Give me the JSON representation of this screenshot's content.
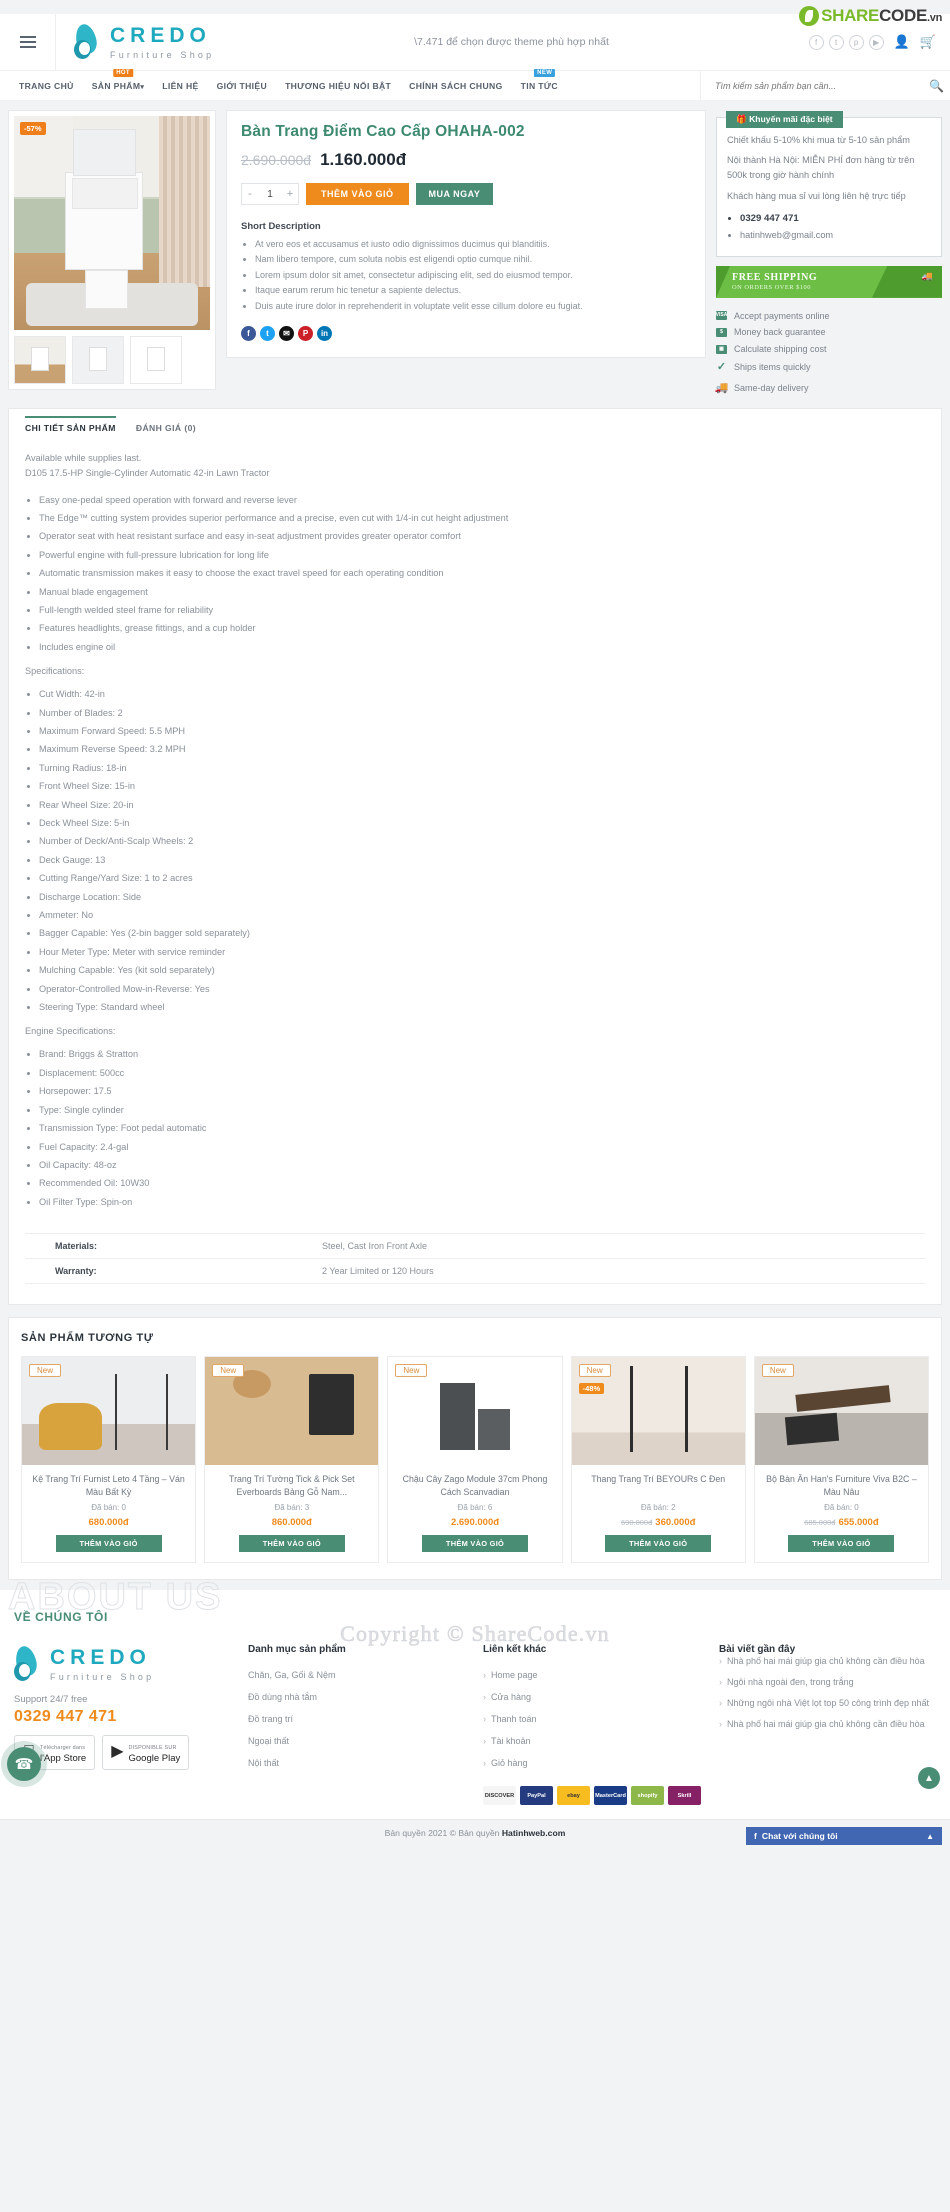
{
  "header": {
    "logo_brand": "CREDO",
    "logo_sub": "Furniture Shop",
    "tagline": "\\7.471 để chọn được theme phù hợp nhất",
    "watermark_brand": "SHARE",
    "watermark_brand2": "CODE",
    "watermark_tld": ".vn",
    "socials": [
      "f",
      "t",
      "p",
      "▶"
    ],
    "account_icon": "user-icon",
    "cart_icon": "cart-icon"
  },
  "nav": {
    "items": [
      {
        "label": "TRANG CHỦ",
        "badge": null
      },
      {
        "label": "SẢN PHẨM",
        "badge": "HOT",
        "caret": "⌄"
      },
      {
        "label": "LIÊN HỆ",
        "badge": null
      },
      {
        "label": "GIỚI THIỆU",
        "badge": null
      },
      {
        "label": "THƯƠNG HIỆU NỔI BẬT",
        "badge": null
      },
      {
        "label": "CHÍNH SÁCH CHUNG",
        "badge": null
      },
      {
        "label": "TIN TỨC",
        "badge": "NEW"
      }
    ],
    "search_placeholder": "Tìm kiếm sản phẩm bạn cần..."
  },
  "product": {
    "sale_tag": "-57%",
    "title": "Bàn Trang Điểm Cao Cấp OHAHA-002",
    "old_price": "2.690.000đ",
    "new_price": "1.160.000đ",
    "qty": "1",
    "minus": "-",
    "plus": "+",
    "add_to_cart": "THÊM VÀO GIỎ",
    "buy_now": "MUA NGAY",
    "short_desc_title": "Short Description",
    "short_desc": [
      "At vero eos et accusamus et iusto odio dignissimos ducimus qui blanditiis.",
      "Nam libero tempore, cum soluta nobis est eligendi optio cumque nihil.",
      "Lorem ipsum dolor sit amet, consectetur adipiscing elit, sed do eiusmod tempor.",
      "Itaque earum rerum hic tenetur a sapiente delectus.",
      "Duis aute irure dolor in reprehenderit in voluptate velit esse cillum dolore eu fugiat."
    ],
    "share": [
      "f",
      "t",
      "✉",
      "P",
      "in"
    ]
  },
  "sidebar": {
    "promo_title": "Khuyến mãi đặc biệt",
    "promo_icon": "gift-icon",
    "promo_paragraphs": [
      "Chiết khấu 5-10% khi mua từ 5-10 sản phẩm",
      "Nội thành Hà Nội: MIỄN PHÍ đơn hàng từ trên 500k trong giờ hành chính",
      "Khách hàng mua sỉ vui lòng liên hệ trực tiếp"
    ],
    "promo_phone": "0329 447 471",
    "promo_email": "hatinhweb@gmail.com",
    "shipping_title": "FREE SHIPPING",
    "shipping_sub": "ON ORDERS OVER $100",
    "shipping_badge": "FREE",
    "features": [
      {
        "icon": "visa-icon",
        "label": "Accept payments online"
      },
      {
        "icon": "money-back-icon",
        "label": "Money back guarantee"
      },
      {
        "icon": "calculator-icon",
        "label": "Calculate shipping cost"
      },
      {
        "icon": "check-icon",
        "label": "Ships items quickly"
      },
      {
        "icon": "truck-icon",
        "label": "Same-day delivery"
      }
    ]
  },
  "detail": {
    "tabs": [
      {
        "label": "CHI TIẾT SẢN PHẨM",
        "active": true
      },
      {
        "label": "ĐÁNH GIÁ (0)",
        "active": false
      }
    ],
    "intro_line1": "Available while supplies last.",
    "intro_line2": "D105 17.5-HP Single-Cylinder Automatic 42-in Lawn Tractor",
    "features": [
      "Easy one-pedal speed operation with forward and reverse lever",
      "The Edge™ cutting system provides superior performance and a precise, even cut with 1/4-in cut height adjustment",
      "Operator seat with heat resistant surface and easy in-seat adjustment provides greater operator comfort",
      "Powerful engine with full-pressure lubrication for long life",
      "Automatic transmission makes it easy to choose the exact travel speed for each operating condition",
      "Manual blade engagement",
      "Full-length welded steel frame for reliability",
      "Features headlights, grease fittings, and a cup holder",
      "Includes engine oil"
    ],
    "spec_heading": "Specifications:",
    "specs": [
      "Cut Width: 42-in",
      "Number of Blades: 2",
      "Maximum Forward Speed: 5.5 MPH",
      "Maximum Reverse Speed: 3.2 MPH",
      "Turning Radius: 18-in",
      "Front Wheel Size: 15-in",
      "Rear Wheel Size: 20-in",
      "Deck Wheel Size: 5-in",
      "Number of Deck/Anti-Scalp Wheels: 2",
      "Deck Gauge: 13",
      "Cutting Range/Yard Size: 1 to 2 acres",
      "Discharge Location: Side",
      "Ammeter: No",
      "Bagger Capable: Yes (2-bin bagger sold separately)",
      "Hour Meter Type: Meter with service reminder",
      "Mulching Capable: Yes (kit sold separately)",
      "Operator-Controlled Mow-in-Reverse: Yes",
      "Steering Type: Standard wheel"
    ],
    "engine_heading": "Engine Specifications:",
    "engine_specs": [
      "Brand: Briggs & Stratton",
      "Displacement: 500cc",
      "Horsepower: 17.5",
      "Type: Single cylinder",
      "Transmission Type: Foot pedal automatic",
      "Fuel Capacity: 2.4-gal",
      "Oil Capacity: 48-oz",
      "Recommended Oil: 10W30",
      "Oil Filter Type: Spin-on"
    ],
    "watermark": "ShareCode.vn",
    "table": [
      {
        "key": "Materials:",
        "value": "Steel, Cast Iron Front Axle"
      },
      {
        "key": "Warranty:",
        "value": "2 Year Limited or 120 Hours"
      }
    ]
  },
  "related": {
    "title": "SẢN PHẨM TƯƠNG TỰ",
    "add_to_cart": "THÊM VÀO GIỎ",
    "cart_icon": "cart-icon",
    "items": [
      {
        "tag": "New",
        "sale": null,
        "name": "Kệ Trang Trí Furnist Leto 4 Tầng – Ván Màu Bất Kỳ",
        "sold": "Đã bán: 0",
        "old_price": null,
        "price": "680.000đ"
      },
      {
        "tag": "New",
        "sale": null,
        "name": "Trang Trí Tường Tick & Pick Set Everboards Bảng Gỗ Nam...",
        "sold": "Đã bán: 3",
        "old_price": null,
        "price": "860.000đ"
      },
      {
        "tag": "New",
        "sale": null,
        "name": "Chậu Cây Zago Module 37cm Phong Cách Scanvadian",
        "sold": "Đã bán: 6",
        "old_price": null,
        "price": "2.690.000đ"
      },
      {
        "tag": "New",
        "sale": "-48%",
        "name": "Thang Trang Trí BEYOURs C Đen",
        "sold": "Đã bán: 2",
        "old_price": "690.000đ",
        "price": "360.000đ"
      },
      {
        "tag": "New",
        "sale": null,
        "name": "Bộ Bàn Ăn Han's Furniture Viva B2C – Màu Nâu",
        "sold": "Đã bán: 0",
        "old_price": "685.000đ",
        "price": "655.000đ"
      }
    ]
  },
  "footer": {
    "ghost_title": "ABOUT US",
    "about_label": "VỀ CHÚNG TÔI",
    "logo_brand": "CREDO",
    "logo_sub": "Furniture Shop",
    "support": "Support 24/7 free",
    "phone": "0329 447 471",
    "stores": [
      {
        "icon": "apple-icon",
        "small": "Télécharger dans",
        "big": "l'App Store"
      },
      {
        "icon": "play-icon",
        "small": "DISPONIBLE SUR",
        "big": "Google Play"
      }
    ],
    "col_categories_title": "Danh mục sản phẩm",
    "col_categories": [
      "Chăn, Ga, Gối & Nệm",
      "Đồ dùng nhà tắm",
      "Đồ trang trí",
      "Ngoại thất",
      "Nội thất"
    ],
    "col_links_title": "Liên kết khác",
    "col_links": [
      "Home page",
      "Cửa hàng",
      "Thanh toán",
      "Tài khoản",
      "Giỏ hàng"
    ],
    "payments": [
      "DISCOVER",
      "PayPal",
      "ebay",
      "MasterCard",
      "shopify",
      "Skrill"
    ],
    "col_news_title": "Bài viết gần đây",
    "col_news": [
      "Nhà phố hai mái giúp gia chủ không cần điều hòa",
      "Ngôi nhà ngoài đen, trong trắng",
      "Những ngôi nhà Việt lọt top 50 công trình đẹp nhất",
      "Nhà phố hai mái giúp gia chủ không cần điều hòa"
    ],
    "copyright_prefix": "Bản quyền 2021 © Bản quyền ",
    "copyright_brand": "Hatinhweb.com",
    "watermark": "Copyright © ShareCode.vn",
    "chat_label": "Chat với chúng tôi",
    "chat_icon": "facebook-icon",
    "phone_fab_icon": "phone-icon",
    "to_top_icon": "chevron-up-icon"
  }
}
